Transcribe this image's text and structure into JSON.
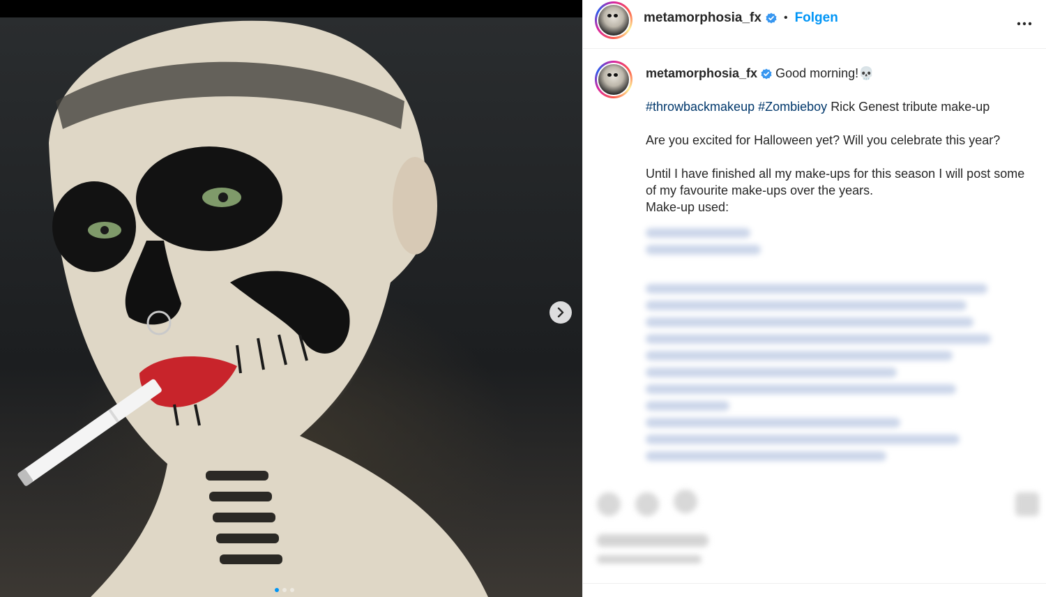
{
  "post": {
    "username": "metamorphosia_fx",
    "follow_label": "Folgen",
    "separator": "•",
    "caption": {
      "greeting": "Good morning!",
      "greeting_emoji": "💀",
      "hashtag_1": "#throwbackmakeup",
      "hashtag_2": "#Zombieboy",
      "tribute_text": "Rick Genest tribute make-up",
      "question": "Are you excited for Halloween yet? Will you celebrate this year?",
      "season_text": "Until I have finished all my make-ups for this season I will post some of my favourite make-ups over the years.",
      "makeup_used": "Make-up used:"
    }
  },
  "media": {
    "carousel_slides": 3,
    "active_slide_index": 0
  },
  "colors": {
    "accent": "#0095f6",
    "hashtag": "#00376b",
    "verified": "#3897f0",
    "text": "#262626"
  },
  "icons": {
    "verified": "verified-badge-icon",
    "more": "more-options-icon",
    "next": "chevron-right-icon"
  }
}
